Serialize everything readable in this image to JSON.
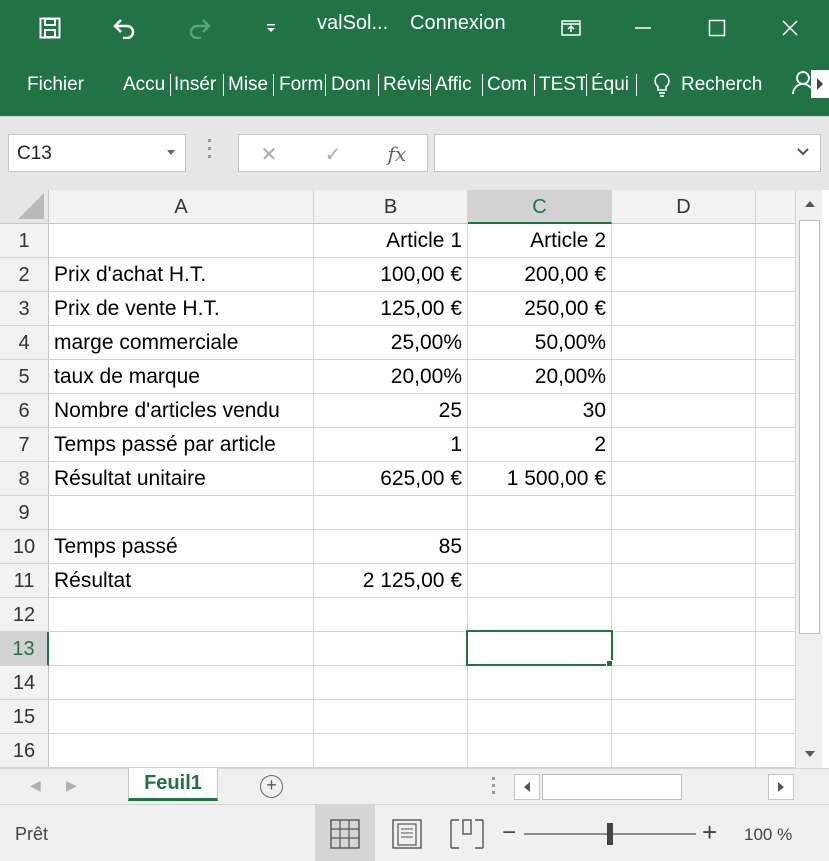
{
  "titlebar": {
    "filename": "valSol...",
    "account": "Connexion"
  },
  "ribbon": {
    "tabs": [
      "Fichier",
      "Accu",
      "Insér",
      "Mise",
      "Form",
      "Donı",
      "Révis",
      "Affic",
      "Com",
      "TEST",
      "Équi"
    ],
    "search_label": "Recherch"
  },
  "formula": {
    "namebox": "C13",
    "cancel_symbol": "✕",
    "confirm_symbol": "✓",
    "fx_symbol": "fx",
    "content": ""
  },
  "grid": {
    "columns": [
      "A",
      "B",
      "C",
      "D"
    ],
    "selected_column": "C",
    "selected_row": "13",
    "rows": [
      {
        "n": "1",
        "a": "",
        "b": "Article 1",
        "c": "Article 2"
      },
      {
        "n": "2",
        "a": "Prix d'achat H.T.",
        "b": "100,00 €",
        "c": "200,00 €"
      },
      {
        "n": "3",
        "a": "Prix de vente H.T.",
        "b": "125,00 €",
        "c": "250,00 €"
      },
      {
        "n": "4",
        "a": "marge commerciale",
        "b": "25,00%",
        "c": "50,00%"
      },
      {
        "n": "5",
        "a": "taux de marque",
        "b": "20,00%",
        "c": "20,00%"
      },
      {
        "n": "6",
        "a": "Nombre d'articles vendu",
        "b": "25",
        "c": "30"
      },
      {
        "n": "7",
        "a": "Temps passé par article",
        "b": "1",
        "c": "2"
      },
      {
        "n": "8",
        "a": "Résultat unitaire",
        "b": "625,00 €",
        "c": "1 500,00 €"
      },
      {
        "n": "9",
        "a": "",
        "b": "",
        "c": ""
      },
      {
        "n": "10",
        "a": "Temps passé",
        "b": "85",
        "c": ""
      },
      {
        "n": "11",
        "a": "Résultat",
        "b": "2 125,00 €",
        "c": ""
      },
      {
        "n": "12",
        "a": "",
        "b": "",
        "c": ""
      },
      {
        "n": "13",
        "a": "",
        "b": "",
        "c": ""
      },
      {
        "n": "14",
        "a": "",
        "b": "",
        "c": ""
      },
      {
        "n": "15",
        "a": "",
        "b": "",
        "c": ""
      },
      {
        "n": "16",
        "a": "",
        "b": "",
        "c": ""
      }
    ]
  },
  "sheets": {
    "active": "Feuil1",
    "add_symbol": "+"
  },
  "status": {
    "text": "Prêt",
    "zoom_minus": "−",
    "zoom_plus": "+",
    "zoom_level": "100 %"
  },
  "colors": {
    "accent": "#217346",
    "ribbon": "#217346",
    "header_bg": "#f2f2f2",
    "gridline": "#d4d4d4"
  },
  "icons": [
    "save-icon",
    "undo-icon",
    "redo-icon",
    "customize-quick-access-icon",
    "ribbon-display-options-icon",
    "minimize-icon",
    "maximize-icon",
    "close-icon",
    "lightbulb-icon",
    "share-icon",
    "chevron-down-icon"
  ]
}
